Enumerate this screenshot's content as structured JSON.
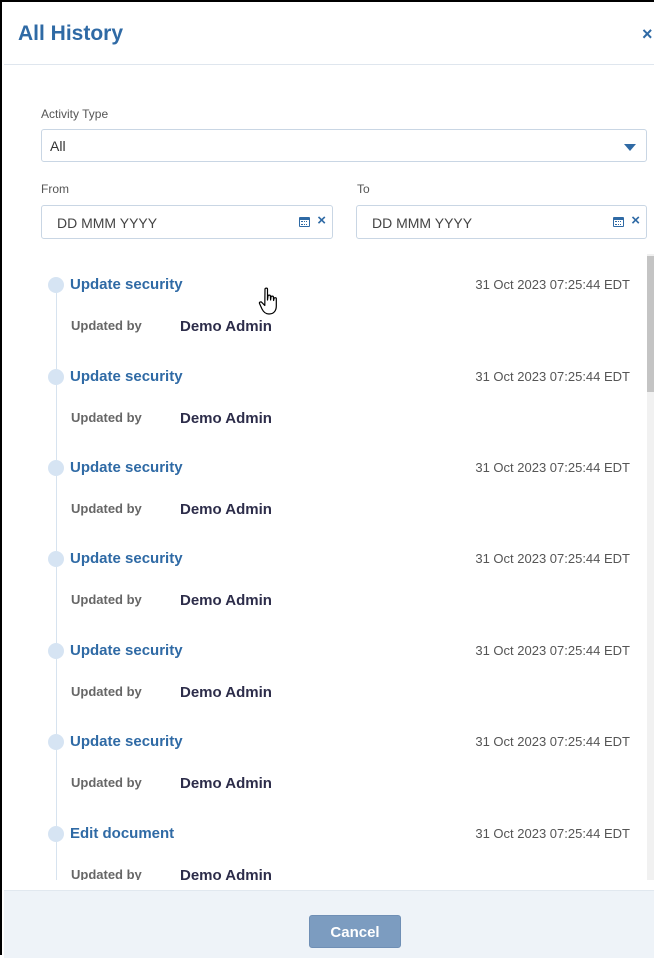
{
  "dialog": {
    "title": "All History",
    "close_icon": "close-icon",
    "close_glyph": "×"
  },
  "filters": {
    "activity_type_label": "Activity Type",
    "activity_type_value": "All",
    "from_label": "From",
    "to_label": "To",
    "from_placeholder": "DD MMM YYYY",
    "to_placeholder": "DD MMM YYYY",
    "clear_glyph": "×"
  },
  "history": {
    "updated_by_label": "Updated by",
    "entries": [
      {
        "action": "Update security",
        "timestamp": "31 Oct 2023 07:25:44 EDT",
        "user": "Demo Admin"
      },
      {
        "action": "Update security",
        "timestamp": "31 Oct 2023 07:25:44 EDT",
        "user": "Demo Admin"
      },
      {
        "action": "Update security",
        "timestamp": "31 Oct 2023 07:25:44 EDT",
        "user": "Demo Admin"
      },
      {
        "action": "Update security",
        "timestamp": "31 Oct 2023 07:25:44 EDT",
        "user": "Demo Admin"
      },
      {
        "action": "Update security",
        "timestamp": "31 Oct 2023 07:25:44 EDT",
        "user": "Demo Admin"
      },
      {
        "action": "Update security",
        "timestamp": "31 Oct 2023 07:25:44 EDT",
        "user": "Demo Admin"
      },
      {
        "action": "Edit document",
        "timestamp": "31 Oct 2023 07:25:44 EDT",
        "user": "Demo Admin"
      }
    ]
  },
  "footer": {
    "cancel_label": "Cancel"
  },
  "colors": {
    "accent": "#2f6aa5",
    "button": "#7c9cc0",
    "footer_bg": "#eef3f8"
  }
}
